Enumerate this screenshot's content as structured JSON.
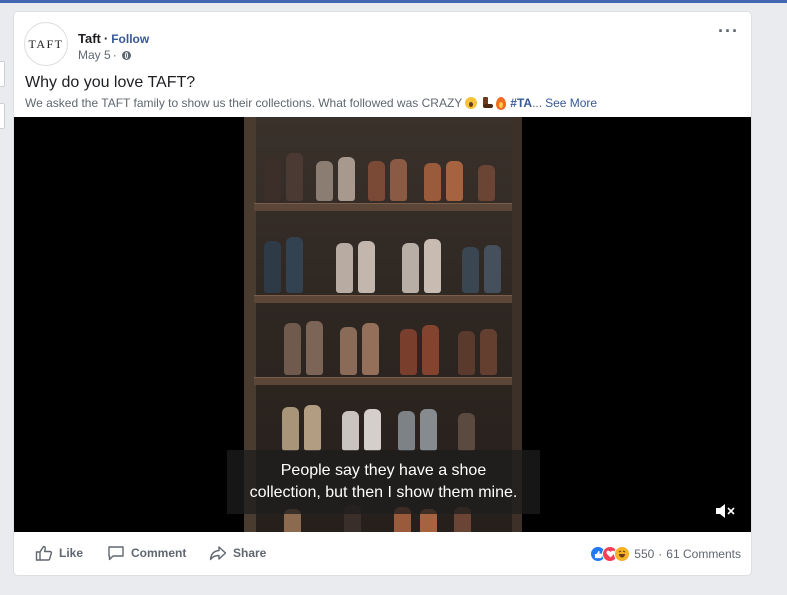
{
  "post": {
    "page_name": "Taft",
    "follow_label": "Follow",
    "date": "May 5",
    "avatar_text": "TAFT",
    "title": "Why do you love TAFT?",
    "description": "We asked the TAFT family to show us their collections. What followed was CRAZY",
    "hashtag": "#TA",
    "ellipsis": "...",
    "see_more": "See More",
    "more_icon": "more-options-icon",
    "privacy_icon": "globe-icon"
  },
  "video": {
    "subtitle_line1": "People say they have a shoe",
    "subtitle_line2": "collection, but then I show them mine.",
    "mute_icon": "speaker-muted-icon"
  },
  "actions": {
    "like": "Like",
    "comment": "Comment",
    "share": "Share"
  },
  "reactions": {
    "count": "550",
    "comments": "61 Comments",
    "types": [
      "like",
      "love",
      "haha"
    ]
  },
  "colors": {
    "link": "#385898",
    "muted": "#606770",
    "like_blue": "#2078f4",
    "love_red": "#f33e58",
    "haha_yellow": "#f7b125"
  }
}
